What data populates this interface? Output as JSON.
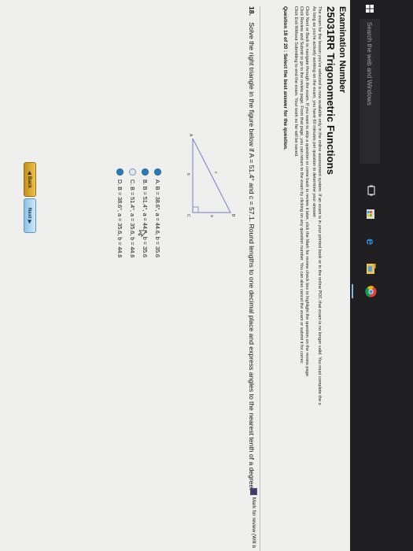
{
  "exam": {
    "title": "Examination Number",
    "code": "25031RR   Trigonometric Functions"
  },
  "instructions": [
    "The exam for the lesson you've selected is now available only in the online assessment system. If an exam is in your printed book or in the online PDF, that exam is no longer valid. You must complete the o",
    "As long as you're actively working on the exam, you have 60 minutes per question to determine your answer.",
    "Click Next or Back to navigate through the exam. If you want to skip a question or come back to review it later, click the Mark for review check box to highlight the question on the review page.",
    "Click Review and Submit to go to the review page. From that page, you can return to the exam by clicking on any question number. You can also cancel the exam or submit it for correc",
    "Click Exit Without Submitting to end the exam. Your work so far will be saved."
  ],
  "question_header": "Question 18 of 20 : Select the best answer for the question.",
  "mark_review_label": "Mark for review (Will b",
  "question": {
    "number": "18.",
    "text": "Solve the right triangle in the figure below if A = 51.4° and c = 57.1. Round lengths to one decimal place and express angles to the nearest tenth of a degree."
  },
  "figure_labels": {
    "a": "A",
    "b": "B",
    "c": "C",
    "side_b": "b",
    "side_a": "a",
    "side_c": "c"
  },
  "choices": [
    {
      "label": "A. B = 38.6°, a = 44.6, b = 35.6",
      "selected": true
    },
    {
      "label": "B. B = 51.4°, a = 44.6, b = 35.6",
      "selected": true
    },
    {
      "label": "C. B = 51.4°, a = 35.6, b = 44.6",
      "selected": false
    },
    {
      "label": "D. B = 38.6°, a = 35.6, b = 44.6",
      "selected": true
    }
  ],
  "buttons": {
    "back": "Back",
    "next": "Next"
  },
  "taskbar": {
    "search_placeholder": "Search the web and Windows"
  },
  "colors": {
    "radio": "#2f7ab8",
    "back": "#f0c14b",
    "next": "#8ec2e5"
  }
}
